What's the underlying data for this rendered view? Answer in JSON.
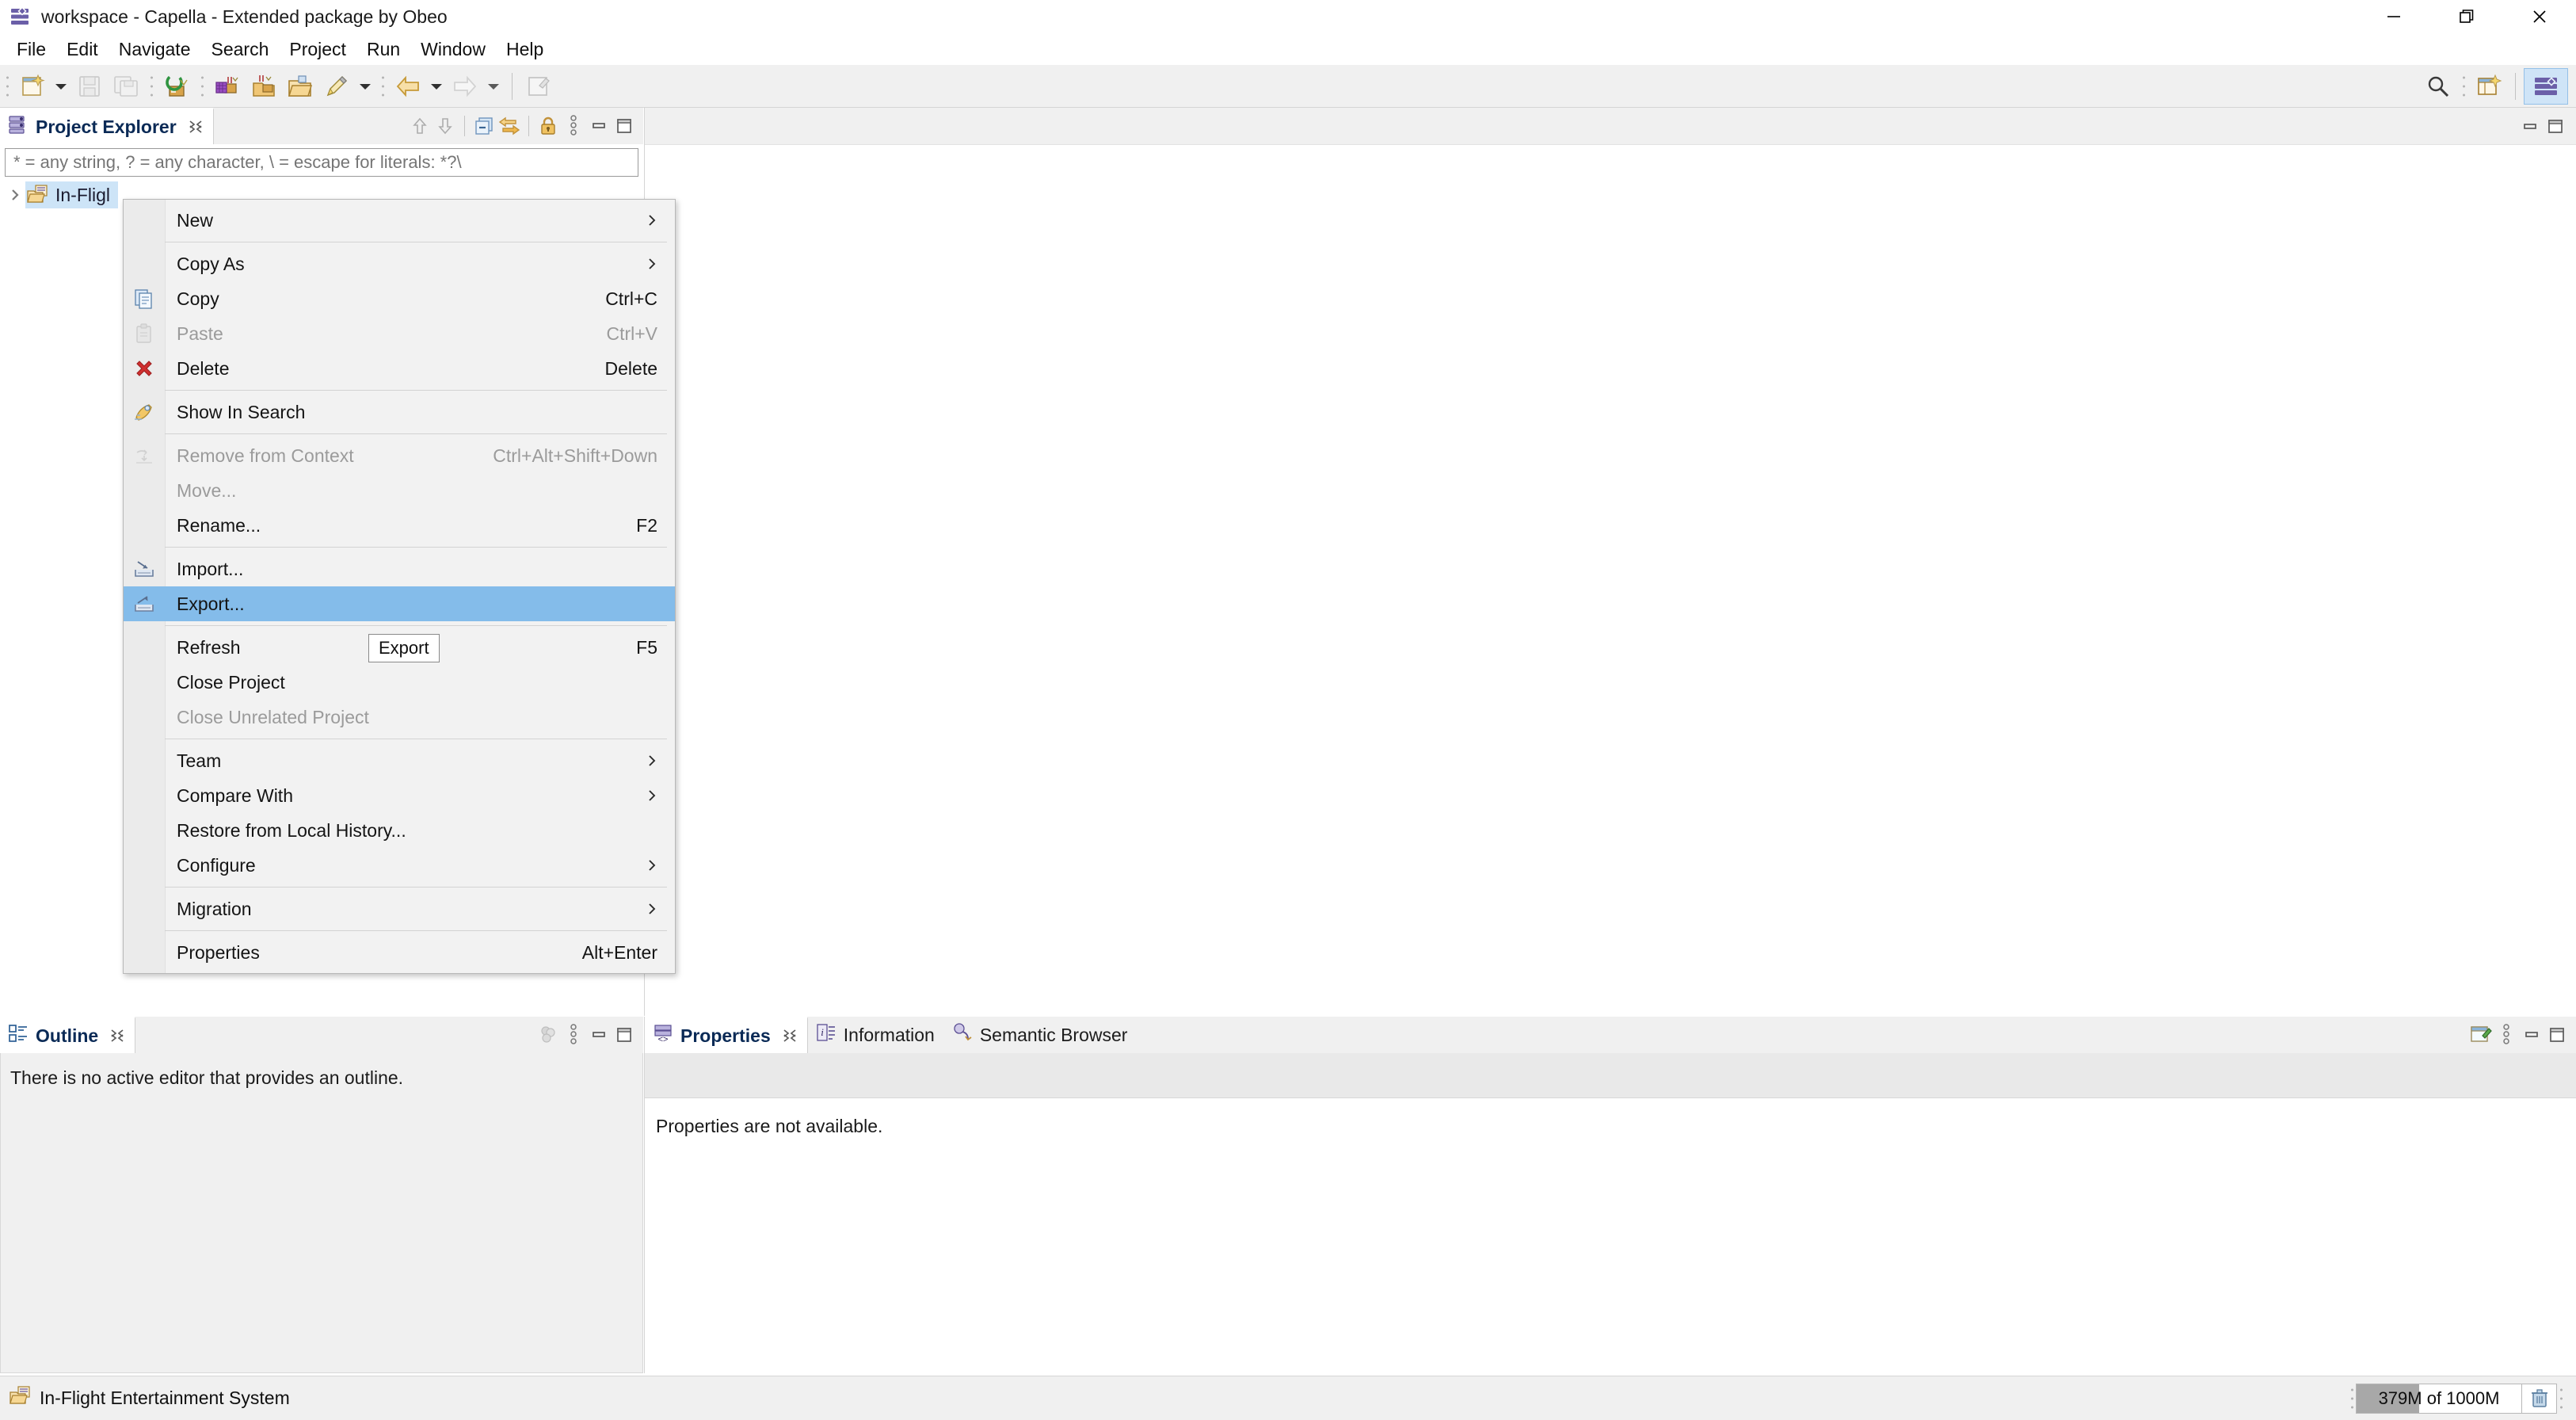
{
  "window": {
    "title": "workspace - Capella - Extended package by Obeo",
    "icon": "capella-logo-icon",
    "controls": {
      "minimize": "minimize-window",
      "restore": "restore-window",
      "close": "close-window"
    }
  },
  "menubar": {
    "items": [
      {
        "label": "File"
      },
      {
        "label": "Edit"
      },
      {
        "label": "Navigate"
      },
      {
        "label": "Search"
      },
      {
        "label": "Project"
      },
      {
        "label": "Run"
      },
      {
        "label": "Window"
      },
      {
        "label": "Help"
      }
    ]
  },
  "toolbar": {
    "items": [
      {
        "name": "new-wizard-icon",
        "type": "button"
      },
      {
        "name": "new-wizard-dropdown-icon",
        "type": "arrow"
      },
      {
        "name": "save-icon",
        "type": "button",
        "disabled": true
      },
      {
        "name": "save-all-icon",
        "type": "button",
        "disabled": true
      },
      {
        "name": "validate-model-icon",
        "type": "button"
      },
      {
        "name": "transition-icon",
        "type": "button"
      },
      {
        "name": "export-transition-icon",
        "type": "button"
      },
      {
        "name": "open-project-icon",
        "type": "button"
      },
      {
        "name": "pencil-edit-icon",
        "type": "button"
      },
      {
        "name": "pencil-dropdown-icon",
        "type": "arrow"
      },
      {
        "name": "back-arrow-icon",
        "type": "button"
      },
      {
        "name": "back-dropdown-icon",
        "type": "arrow"
      },
      {
        "name": "forward-arrow-icon",
        "type": "button",
        "disabled": true
      },
      {
        "name": "forward-dropdown-icon",
        "type": "arrow"
      },
      {
        "name": "new-editor-icon",
        "type": "button",
        "disabled": true
      }
    ],
    "right": [
      {
        "name": "search-icon"
      },
      {
        "name": "open-perspective-icon"
      },
      {
        "name": "capella-perspective-icon",
        "active": true
      }
    ]
  },
  "project_explorer": {
    "tab_label": "Project Explorer",
    "tab_icon": "project-explorer-icon",
    "close_icon": "close-tab-icon",
    "tools": [
      {
        "name": "collapse-up-icon"
      },
      {
        "name": "expand-down-icon"
      },
      {
        "name": "collapse-all-icon"
      },
      {
        "name": "link-with-editor-icon"
      },
      {
        "name": "lock-icon"
      },
      {
        "name": "view-menu-icon"
      },
      {
        "name": "minimize-view-icon"
      },
      {
        "name": "maximize-view-icon"
      }
    ],
    "filter": {
      "value": "",
      "placeholder": "* = any string, ? = any character, \\ = escape for literals: *?\\"
    },
    "tree": [
      {
        "label": "In-Fligl",
        "icon": "capella-project-icon",
        "expanded": false,
        "selected": true
      }
    ]
  },
  "context_menu": {
    "items": [
      {
        "label": "New",
        "submenu": true,
        "icon": null
      },
      {
        "divider": true
      },
      {
        "label": "Copy As",
        "submenu": true,
        "icon": null
      },
      {
        "label": "Copy",
        "accel": "Ctrl+C",
        "icon": "copy-icon"
      },
      {
        "label": "Paste",
        "accel": "Ctrl+V",
        "icon": "paste-icon",
        "disabled": true
      },
      {
        "label": "Delete",
        "accel": "Delete",
        "icon": "delete-x-icon"
      },
      {
        "divider": true
      },
      {
        "label": "Show In Search",
        "icon": "show-in-search-icon"
      },
      {
        "divider": true
      },
      {
        "label": "Remove from Context",
        "accel": "Ctrl+Alt+Shift+Down",
        "icon": "remove-from-context-icon",
        "disabled": true
      },
      {
        "label": "Move...",
        "icon": null,
        "disabled": true
      },
      {
        "label": "Rename...",
        "accel": "F2",
        "icon": null
      },
      {
        "divider": true
      },
      {
        "label": "Import...",
        "icon": "import-icon"
      },
      {
        "label": "Export...",
        "icon": "export-icon",
        "selected": true
      },
      {
        "divider": true
      },
      {
        "label": "Refresh",
        "accel": "F5",
        "icon": null
      },
      {
        "label": "Close Project",
        "icon": null
      },
      {
        "label": "Close Unrelated Project",
        "icon": null,
        "disabled": true
      },
      {
        "divider": true
      },
      {
        "label": "Team",
        "submenu": true,
        "icon": null
      },
      {
        "label": "Compare With",
        "submenu": true,
        "icon": null
      },
      {
        "label": "Restore from Local History...",
        "icon": null
      },
      {
        "label": "Configure",
        "submenu": true,
        "icon": null
      },
      {
        "divider": true
      },
      {
        "label": "Migration",
        "submenu": true,
        "icon": null
      },
      {
        "divider": true
      },
      {
        "label": "Properties",
        "accel": "Alt+Enter",
        "icon": null
      }
    ]
  },
  "tooltip": {
    "text": "Export"
  },
  "outline": {
    "tab_label": "Outline",
    "tab_icon": "outline-icon",
    "close_icon": "close-tab-icon",
    "message": "There is no active editor that provides an outline.",
    "tools": [
      {
        "name": "sort-filter-icon"
      },
      {
        "name": "view-menu-icon"
      },
      {
        "name": "minimize-view-icon"
      },
      {
        "name": "maximize-view-icon"
      }
    ]
  },
  "properties": {
    "tabs": [
      {
        "label": "Properties",
        "icon": "properties-icon",
        "active": true,
        "close_icon": "close-tab-icon"
      },
      {
        "label": "Information",
        "icon": "information-icon",
        "active": false
      },
      {
        "label": "Semantic Browser",
        "icon": "semantic-browser-icon",
        "active": false
      }
    ],
    "message": "Properties are not available.",
    "tools": [
      {
        "name": "pin-view-icon"
      },
      {
        "name": "view-menu-icon"
      },
      {
        "name": "minimize-view-icon"
      },
      {
        "name": "maximize-view-icon"
      }
    ]
  },
  "statusbar": {
    "selection_icon": "capella-project-icon",
    "selection_text": "In-Flight Entertainment System",
    "heap": {
      "label": "379M of 1000M",
      "used_mb": 379,
      "total_mb": 1000,
      "fill_percent": 37.9,
      "trash_icon": "trash-icon"
    }
  },
  "colors": {
    "menu_highlight": "#84bcea",
    "tree_selection": "#cde4f7",
    "toolbar_bg": "#f0f0f0",
    "menu_bg": "#f2f2f2",
    "tab_text": "#0a2a56"
  }
}
